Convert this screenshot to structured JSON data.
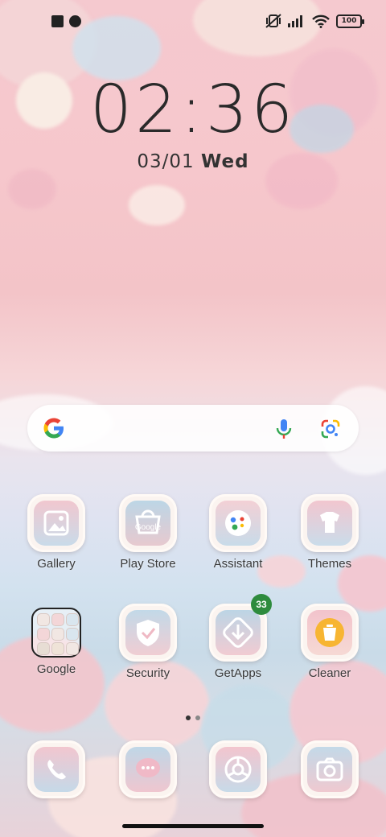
{
  "status_bar": {
    "battery": "100"
  },
  "lock": {
    "time": "02:36",
    "date": "03/01",
    "weekday": "Wed"
  },
  "search": {
    "icons": [
      "google-logo-icon",
      "mic-icon",
      "lens-icon"
    ]
  },
  "apps_row1": [
    {
      "label": "Gallery",
      "icon": "gallery-icon"
    },
    {
      "label": "Play Store",
      "icon": "play-store-icon",
      "icon_text": "Google"
    },
    {
      "label": "Assistant",
      "icon": "assistant-icon"
    },
    {
      "label": "Themes",
      "icon": "themes-icon"
    }
  ],
  "apps_row2": [
    {
      "label": "Google",
      "icon": "folder-icon"
    },
    {
      "label": "Security",
      "icon": "security-icon"
    },
    {
      "label": "GetApps",
      "icon": "getapps-icon",
      "badge": "33"
    },
    {
      "label": "Cleaner",
      "icon": "cleaner-icon"
    }
  ],
  "dock": [
    {
      "icon": "phone-icon"
    },
    {
      "icon": "messages-icon"
    },
    {
      "icon": "browser-icon"
    },
    {
      "icon": "camera-icon"
    }
  ],
  "page_indicator": {
    "pages": 2,
    "current": 1
  }
}
